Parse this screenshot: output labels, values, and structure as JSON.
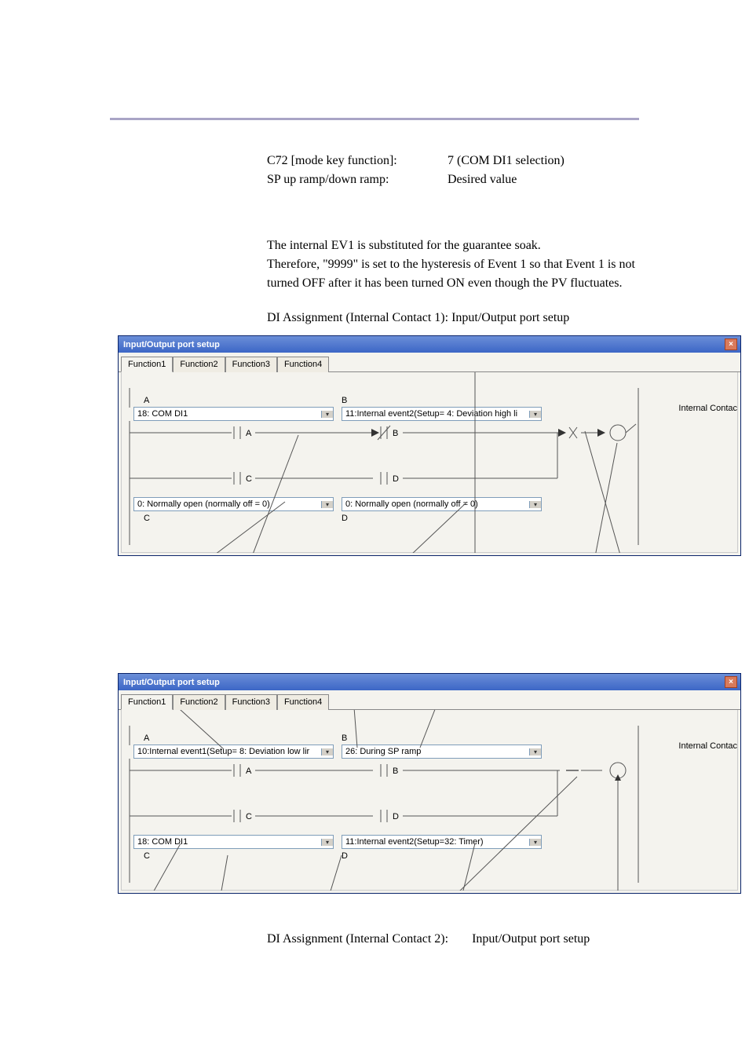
{
  "paramRow1": {
    "key": "C72 [mode key function]:",
    "val": "7 (COM DI1 selection)"
  },
  "paramRow2": {
    "key": "SP up ramp/down ramp:",
    "val": "Desired value"
  },
  "para1": "The internal EV1 is substituted for the guarantee soak.",
  "para2": "Therefore, \"9999\" is set to the hysteresis of Event 1 so that Event 1 is not turned OFF after it has been turned ON even though the PV fluctuates.",
  "subhead1": "DI Assignment (Internal Contact 1): Input/Output port setup",
  "dialog1": {
    "title": "Input/Output port setup",
    "tabs": [
      "Function1",
      "Function2",
      "Function3",
      "Function4"
    ],
    "labelA": "A",
    "labelB": "B",
    "labelC": "C",
    "labelD": "D",
    "selA": "18: COM DI1",
    "selB": "11:Internal event2(Setup= 4: Deviation high li",
    "selC": "0: Normally open (normally off = 0)",
    "selD": "0: Normally open (normally off = 0)",
    "contactA": "A",
    "contactB": "B",
    "contactC": "C",
    "contactD": "D",
    "internal": "Internal Contac"
  },
  "dialog2": {
    "title": "Input/Output port setup",
    "tabs": [
      "Function1",
      "Function2",
      "Function3",
      "Function4"
    ],
    "labelA": "A",
    "labelB": "B",
    "labelC": "C",
    "labelD": "D",
    "selA": "10:Internal event1(Setup= 8: Deviation low lir",
    "selB": "26: During SP ramp",
    "selC": "18: COM DI1",
    "selD": "11:Internal event2(Setup=32: Timer)",
    "contactA": "A",
    "contactB": "B",
    "contactC": "C",
    "contactD": "D",
    "internal": "Internal Contac"
  },
  "caption2a": "DI Assignment (Internal Contact 2):",
  "caption2b": "Input/Output port setup"
}
